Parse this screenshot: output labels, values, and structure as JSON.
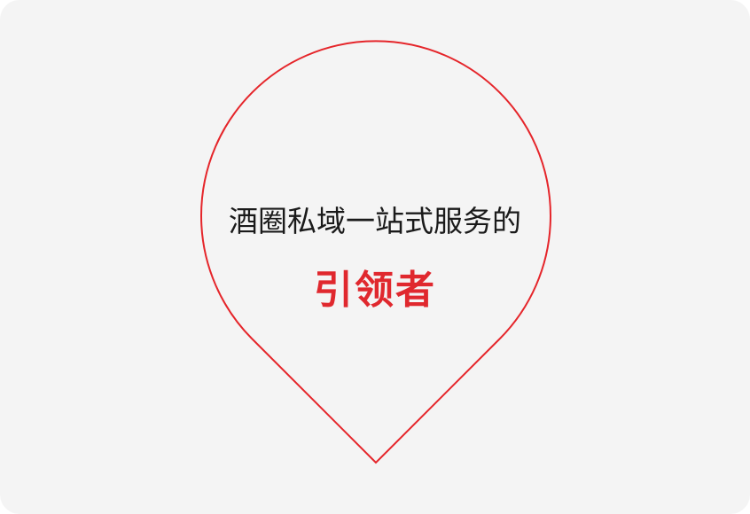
{
  "headline": {
    "line1": "酒圈私域一站式服务的",
    "line2": "引领者"
  },
  "colors": {
    "background": "#f4f4f4",
    "pin_outline": "#e5252a",
    "line1_text": "#1a1a1a",
    "line2_text": "#e0282e"
  },
  "icons": {
    "pin": "map-pin-outline-icon"
  }
}
